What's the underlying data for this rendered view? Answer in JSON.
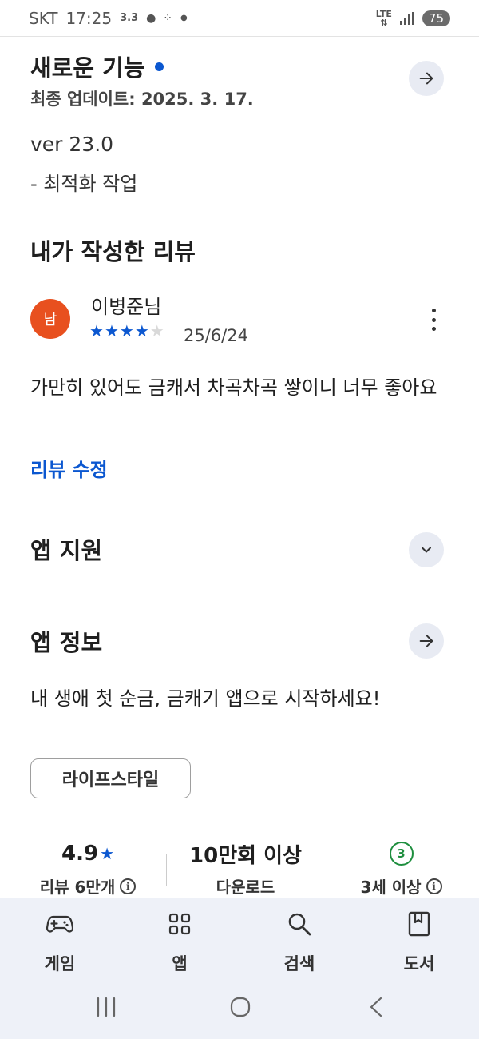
{
  "status_bar": {
    "carrier": "SKT",
    "time": "17:25",
    "extra": "3.3",
    "network": "LTE",
    "battery": "75"
  },
  "whats_new": {
    "title": "새로운 기능",
    "last_updated": "최종 업데이트: 2025. 3. 17.",
    "version": "ver 23.0",
    "note": "- 최적화 작업"
  },
  "my_review": {
    "section_title": "내가 작성한 리뷰",
    "avatar_text": "남",
    "reviewer": "이병준님",
    "rating": 4,
    "rating_max": 5,
    "date": "25/6/24",
    "text": "가만히 있어도 금캐서 차곡차곡 쌓이니 너무 좋아요",
    "edit_label": "리뷰 수정"
  },
  "app_support": {
    "title": "앱 지원"
  },
  "app_info": {
    "title": "앱 정보",
    "description": "내 생애 첫 순금, 금캐기 앱으로 시작하세요!",
    "category": "라이프스타일"
  },
  "stats": {
    "rating_value": "4.9",
    "rating_label": "리뷰 6만개",
    "downloads_value": "10만회 이상",
    "downloads_label": "다운로드",
    "age_badge": "3",
    "age_label": "3세 이상"
  },
  "bottom_nav": {
    "items": [
      {
        "label": "게임",
        "icon": "gamepad-icon"
      },
      {
        "label": "앱",
        "icon": "apps-grid-icon"
      },
      {
        "label": "검색",
        "icon": "search-icon"
      },
      {
        "label": "도서",
        "icon": "book-icon"
      }
    ]
  },
  "colors": {
    "accent": "#0b57d0",
    "avatar": "#e8501f",
    "age_badge": "#1e8e3e",
    "nav_background": "#eef1f8"
  }
}
